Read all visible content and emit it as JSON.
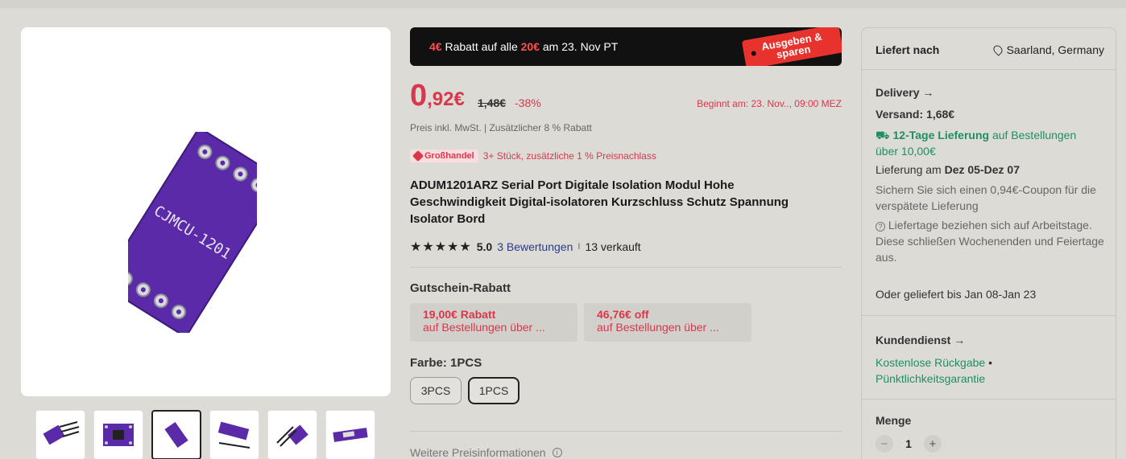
{
  "promo": {
    "amount": "4€",
    "text1": " Rabatt auf alle ",
    "threshold": "20€",
    "text2": " am 23. Nov PT",
    "tag_line1": "Ausgeben &",
    "tag_line2": "sparen"
  },
  "price": {
    "main": "0",
    "fraction": ",92€",
    "old": "1,48€",
    "discount": "-38%",
    "starts": "Beginnt am: 23. Nov.., 09:00 MEZ",
    "tax_note": "Preis inkl. MwSt. | Zusätzlicher 8 % Rabatt"
  },
  "wholesale": {
    "badge": "Großhandel",
    "text": "3+ Stück, zusätzliche 1 % Preisnachlass"
  },
  "product": {
    "title": "ADUM1201ARZ Serial Port Digitale Isolation Modul Hohe Geschwindigkeit Digital-isolatoren Kurzschluss Schutz Spannung Isolator Bord",
    "pcb_label": "CJMCU-1201"
  },
  "rating": {
    "stars": "★★★★★",
    "score": "5.0",
    "reviews": "3 Bewertungen",
    "sep": "I",
    "sold": "13 verkauft"
  },
  "coupons": {
    "heading": "Gutschein-Rabatt",
    "items": [
      {
        "title": "19,00€ Rabatt",
        "sub": "auf Bestellungen über ..."
      },
      {
        "title": "46,76€ off",
        "sub": "auf Bestellungen über ..."
      }
    ]
  },
  "color": {
    "heading": "Farbe: 1PCS",
    "options": [
      "3PCS",
      "1PCS"
    ],
    "selected": "1PCS"
  },
  "more_info": "Weitere Preisinformationen",
  "panel": {
    "ships_to_label": "Liefert nach",
    "ships_to_location": "Saarland, Germany",
    "delivery_heading": "Delivery",
    "shipping": "Versand: 1,68€",
    "fast_bold": "12-Tage Lieferung",
    "fast_rest": " auf Bestellungen",
    "fast_line2": "über 10,00€",
    "delivery_date_prefix": "Lieferung am ",
    "delivery_date": "Dez 05-Dez 07",
    "coupon_note": "Sichern Sie sich einen 0,94€-Coupon für die verspätete Lieferung",
    "workdays_note": "Liefertage beziehen sich auf Arbeitstage. Diese schließen Wochenenden und Feiertage aus.",
    "alt_delivery": "Oder geliefert bis Jan 08-Jan 23",
    "service_heading": "Kundendienst",
    "service_1": "Kostenlose Rückgabe",
    "service_dot": " •",
    "service_2": "Pünktlichkeitsgarantie",
    "quantity_heading": "Menge",
    "quantity": "1"
  },
  "colors": {
    "accent_red": "#d9374b",
    "green": "#1f8f63",
    "pcb_purple": "#5b2aa8"
  }
}
